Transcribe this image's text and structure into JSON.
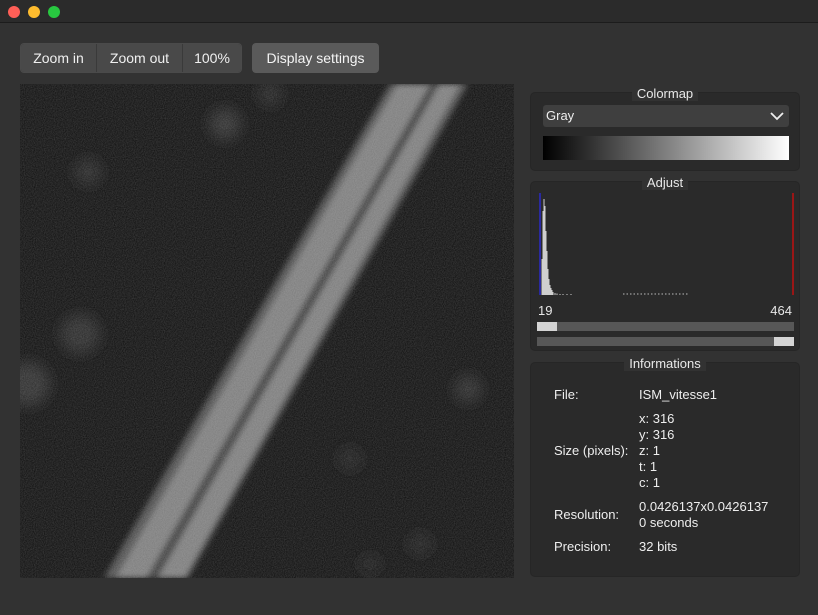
{
  "toolbar": {
    "zoom_in": "Zoom in",
    "zoom_out": "Zoom out",
    "zoom_level": "100%",
    "display_settings": "Display settings"
  },
  "colormap": {
    "title": "Colormap",
    "selected": "Gray"
  },
  "adjust": {
    "title": "Adjust",
    "min": "19",
    "max": "464",
    "min_slider_fraction": 0.0,
    "max_slider_fraction": 1.0
  },
  "info": {
    "title": "Informations",
    "file_label": "File:",
    "file_value": "ISM_vitesse1",
    "size_label": "Size (pixels):",
    "size_x": "x: 316",
    "size_y": "y: 316",
    "size_z": "z: 1",
    "size_t": "t: 1",
    "size_c": "c: 1",
    "resolution_label": "Resolution:",
    "resolution_value": "0.0426137x0.0426137",
    "resolution_time": "0 seconds",
    "precision_label": "Precision:",
    "precision_value": "32 bits"
  },
  "colors": {
    "background": "#323232",
    "histogram_min_marker": "#2a2aa0",
    "histogram_max_marker": "#c01010"
  }
}
